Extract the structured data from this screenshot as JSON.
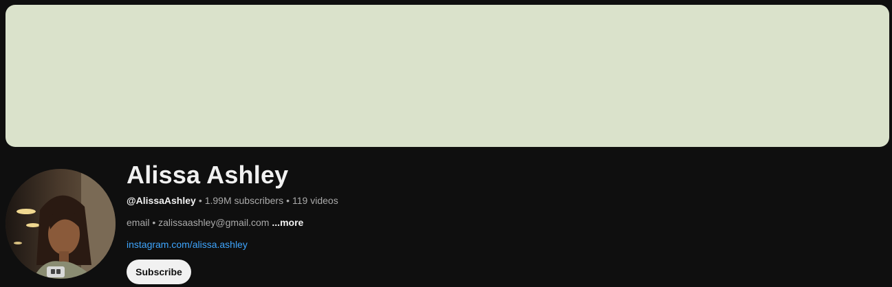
{
  "channel": {
    "name": "Alissa Ashley",
    "handle": "@AlissaAshley",
    "subscribers": "1.99M subscribers",
    "videos": "119 videos",
    "separator": "•",
    "description": "email • zalissaashley@gmail.com",
    "more_label": "...more",
    "link": "instagram.com/alissa.ashley",
    "subscribe_label": "Subscribe"
  },
  "colors": {
    "background": "#0f0f0f",
    "banner": "#dae2cb",
    "link": "#3ea6ff",
    "text_primary": "#f1f1f1",
    "text_secondary": "#aaaaaa"
  }
}
